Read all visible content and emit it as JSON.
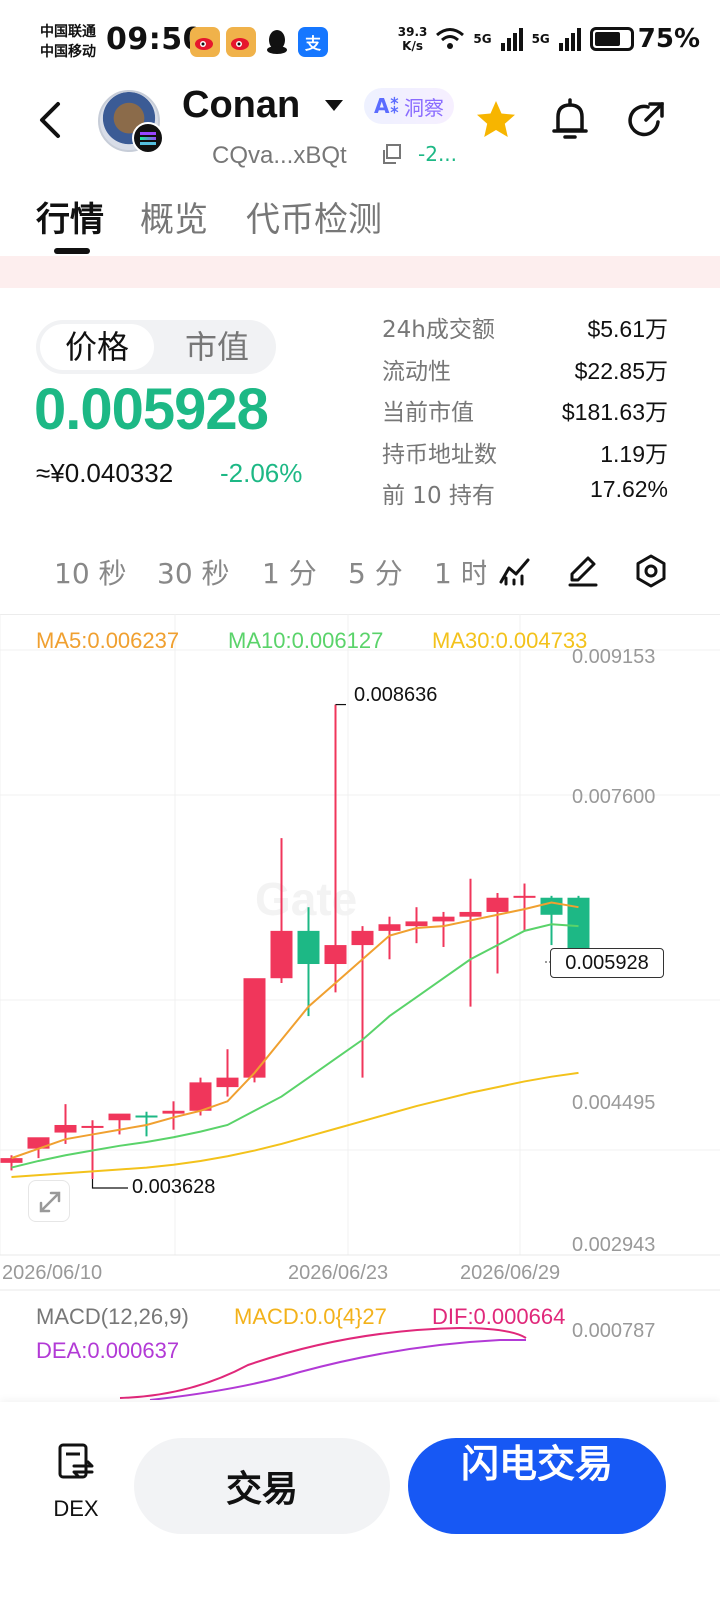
{
  "status_bar": {
    "carrier1": "中国联通",
    "carrier2": "中国移动",
    "time": "09:50",
    "net_speed_value": "39.3",
    "net_speed_unit": "K/s",
    "signal1": "5G",
    "signal2": "5G",
    "battery": "75%",
    "battery_level": 0.75
  },
  "header": {
    "token_name": "Conan",
    "ai_label": "洞察",
    "address": "CQva...xBQt",
    "change": "-2..."
  },
  "tabs": [
    "行情",
    "概览",
    "代币检测"
  ],
  "price_toggle": [
    "价格",
    "市值"
  ],
  "price": {
    "main": "0.005928",
    "cny": "≈¥0.040332",
    "change": "-2.06%"
  },
  "stats": [
    {
      "label": "24h成交额",
      "value": "$5.61万"
    },
    {
      "label": "流动性",
      "value": "$22.85万"
    },
    {
      "label": "当前市值",
      "value": "$181.63万"
    },
    {
      "label": "持币地址数",
      "value": "1.19万"
    },
    {
      "label": "前 10 持有",
      "value": "17.62%"
    }
  ],
  "intervals": [
    "10 秒",
    "30 秒",
    "1 分",
    "5 分",
    "1 时"
  ],
  "chart_data": {
    "type": "candlestick",
    "ma_legend": [
      {
        "label": "MA5:0.006237",
        "color": "#f0a030"
      },
      {
        "label": "MA10:0.006127",
        "color": "#5ad36a"
      },
      {
        "label": "MA30:0.004733",
        "color": "#f3c21b"
      }
    ],
    "y_axis_labels": [
      "0.009153",
      "0.007600",
      "0.004495",
      "0.002943"
    ],
    "x_axis_labels": [
      "2026/06/10",
      "2026/06/23",
      "2026/06/29"
    ],
    "high_annotation": "0.008636",
    "low_annotation": "0.003628",
    "last_price_tag": "0.005928",
    "ylim": [
      0.002943,
      0.009153
    ],
    "candles": [
      {
        "o": 0.0038,
        "h": 0.00388,
        "l": 0.00372,
        "c": 0.00385,
        "up": true
      },
      {
        "o": 0.00395,
        "h": 0.00405,
        "l": 0.00385,
        "c": 0.00407,
        "up": true
      },
      {
        "o": 0.00412,
        "h": 0.00442,
        "l": 0.004,
        "c": 0.0042,
        "up": true
      },
      {
        "o": 0.00418,
        "h": 0.00425,
        "l": 0.00363,
        "c": 0.00419,
        "up": true
      },
      {
        "o": 0.00425,
        "h": 0.0043,
        "l": 0.0041,
        "c": 0.00432,
        "up": true
      },
      {
        "o": 0.0043,
        "h": 0.00434,
        "l": 0.00408,
        "c": 0.0043,
        "up": false
      },
      {
        "o": 0.00432,
        "h": 0.00445,
        "l": 0.00415,
        "c": 0.00435,
        "up": true
      },
      {
        "o": 0.00435,
        "h": 0.0047,
        "l": 0.0043,
        "c": 0.00465,
        "up": true
      },
      {
        "o": 0.0046,
        "h": 0.005,
        "l": 0.0045,
        "c": 0.0047,
        "up": true
      },
      {
        "o": 0.0047,
        "h": 0.0057,
        "l": 0.00465,
        "c": 0.00575,
        "up": true
      },
      {
        "o": 0.00575,
        "h": 0.00723,
        "l": 0.0057,
        "c": 0.00625,
        "up": true
      },
      {
        "o": 0.00625,
        "h": 0.0065,
        "l": 0.00535,
        "c": 0.0059,
        "up": false
      },
      {
        "o": 0.0059,
        "h": 0.00864,
        "l": 0.0056,
        "c": 0.0061,
        "up": true
      },
      {
        "o": 0.0061,
        "h": 0.0063,
        "l": 0.0047,
        "c": 0.00625,
        "up": true
      },
      {
        "o": 0.00625,
        "h": 0.0064,
        "l": 0.00595,
        "c": 0.00632,
        "up": true
      },
      {
        "o": 0.0063,
        "h": 0.0065,
        "l": 0.00612,
        "c": 0.00635,
        "up": true
      },
      {
        "o": 0.00635,
        "h": 0.00645,
        "l": 0.00608,
        "c": 0.0064,
        "up": true
      },
      {
        "o": 0.0064,
        "h": 0.0068,
        "l": 0.00545,
        "c": 0.00645,
        "up": true
      },
      {
        "o": 0.00645,
        "h": 0.00665,
        "l": 0.0058,
        "c": 0.0066,
        "up": true
      },
      {
        "o": 0.0066,
        "h": 0.00675,
        "l": 0.00625,
        "c": 0.00662,
        "up": true
      },
      {
        "o": 0.0066,
        "h": 0.00662,
        "l": 0.0061,
        "c": 0.00642,
        "up": false
      },
      {
        "o": 0.0066,
        "h": 0.00662,
        "l": 0.00605,
        "c": 0.00593,
        "up": false
      }
    ],
    "ma5": [
      0.00385,
      0.00395,
      0.00405,
      0.0041,
      0.00415,
      0.0042,
      0.00428,
      0.00435,
      0.00445,
      0.00475,
      0.0051,
      0.00545,
      0.0057,
      0.00595,
      0.0062,
      0.00628,
      0.0063,
      0.00636,
      0.00642,
      0.00648,
      0.00655,
      0.0065
    ],
    "ma10": [
      0.00375,
      0.00382,
      0.00388,
      0.00393,
      0.00398,
      0.00402,
      0.00407,
      0.00413,
      0.0042,
      0.00435,
      0.0045,
      0.0047,
      0.0049,
      0.0051,
      0.00535,
      0.00555,
      0.00575,
      0.00595,
      0.0061,
      0.00625,
      0.00632,
      0.0063
    ],
    "ma30": [
      0.00365,
      0.00367,
      0.00369,
      0.00371,
      0.00373,
      0.00375,
      0.00378,
      0.00382,
      0.00387,
      0.00393,
      0.004,
      0.00408,
      0.00416,
      0.00424,
      0.00432,
      0.0044,
      0.00447,
      0.00454,
      0.0046,
      0.00466,
      0.00471,
      0.00475
    ]
  },
  "macd": {
    "title": "MACD(12,26,9)",
    "macd_value": "MACD:0.0{4}27",
    "dif": "DIF:0.000664",
    "dea": "DEA:0.000637",
    "axis_label": "0.000787"
  },
  "bottom": {
    "dex": "DEX",
    "trade": "交易",
    "flash_trade": "闪电交易"
  },
  "watermark": "Gate",
  "colors": {
    "up": "#f0365b",
    "down": "#1db885",
    "accent": "#1758f4"
  }
}
